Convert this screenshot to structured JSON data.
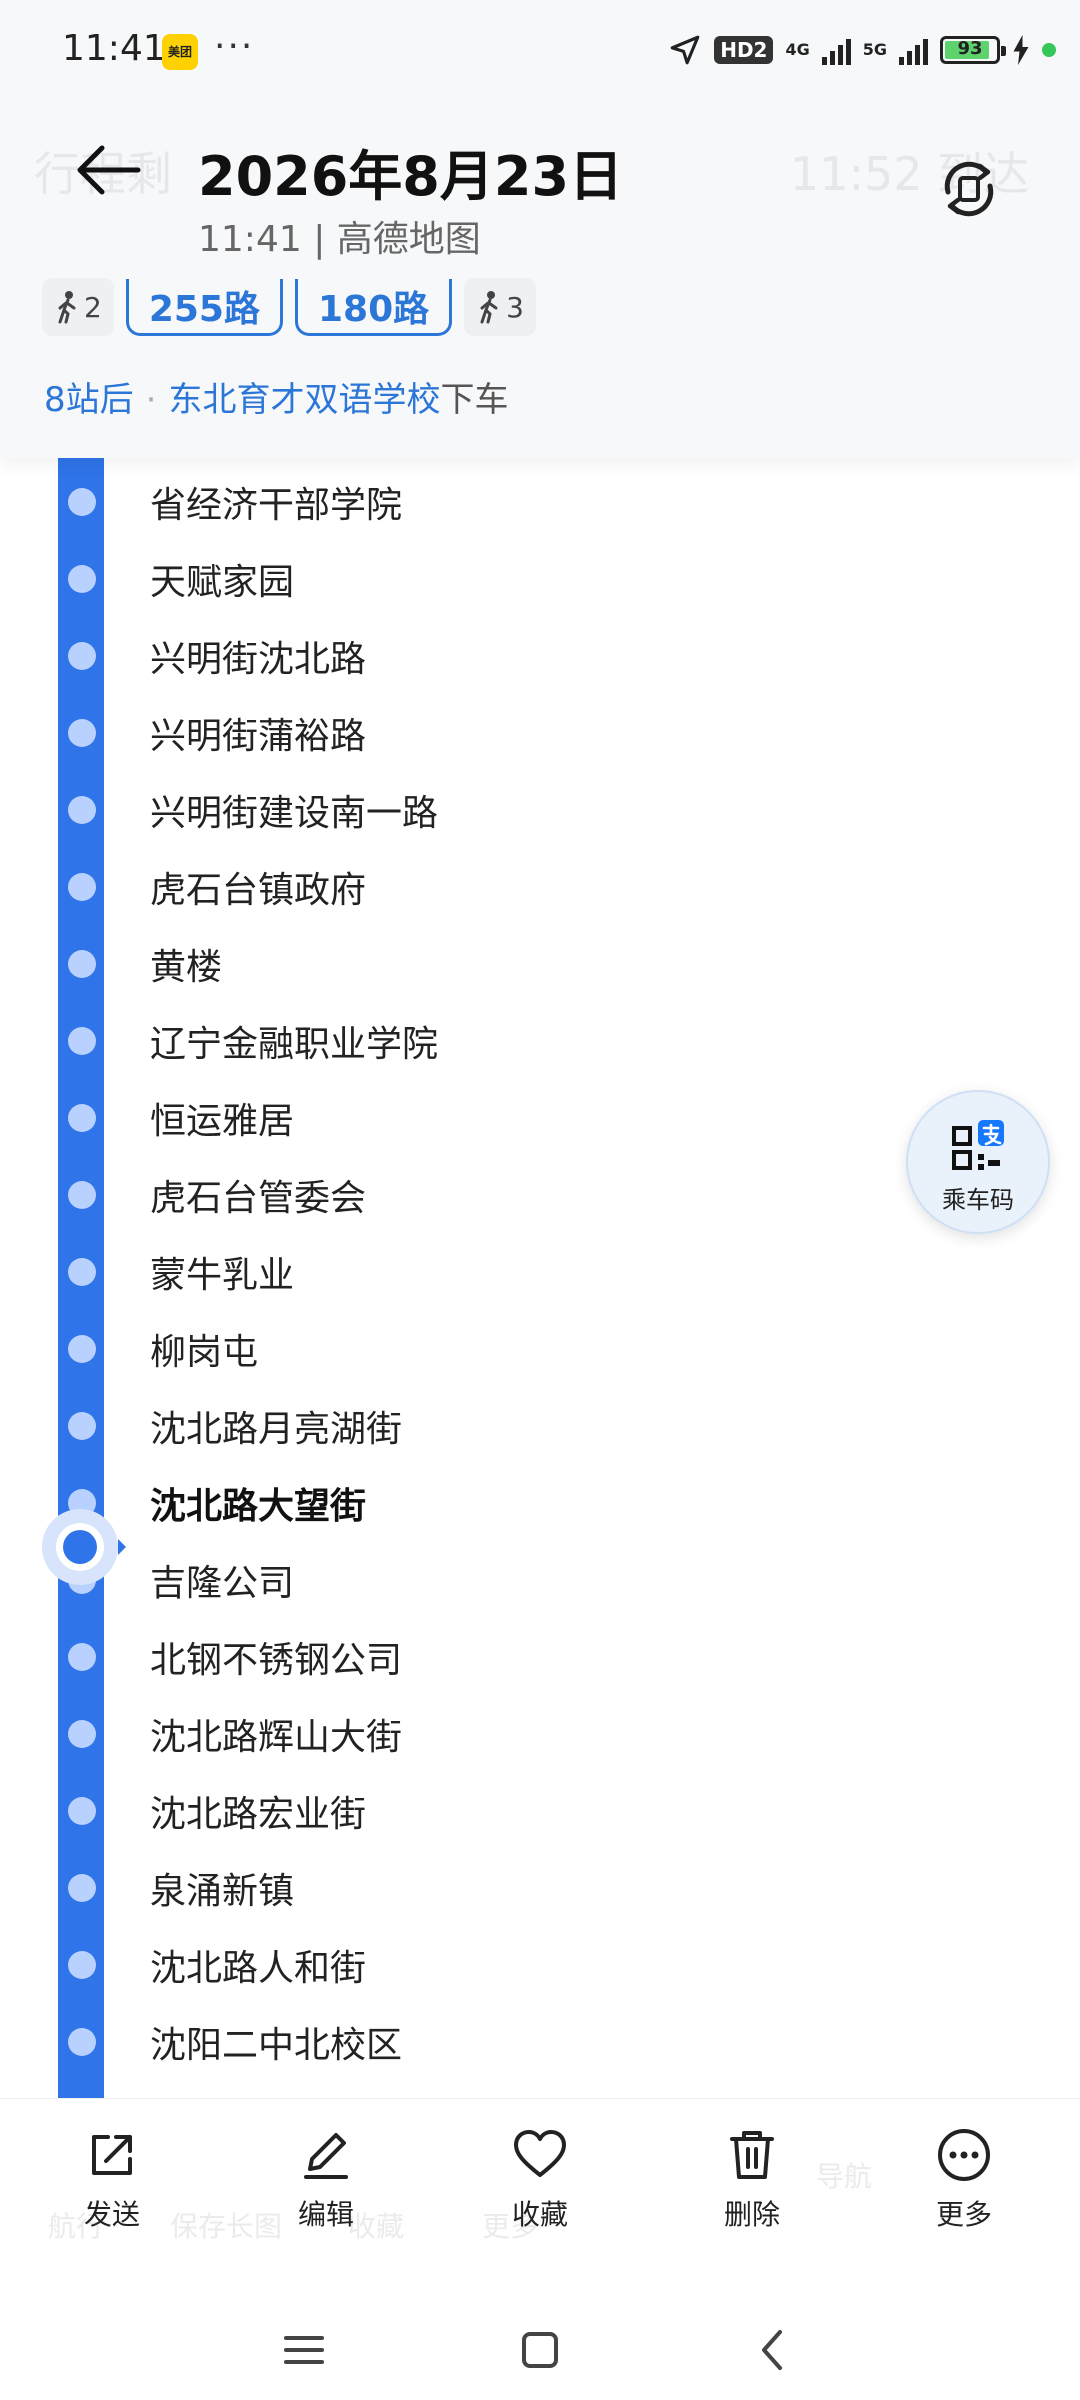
{
  "status_bar": {
    "time": "11:41",
    "app_badge": "美团",
    "more": "···",
    "hd": "HD2",
    "net1": "4G",
    "net2": "5G",
    "battery": "93",
    "icons": [
      "location-arrow-icon",
      "signal-icon",
      "battery-icon",
      "charging-icon"
    ]
  },
  "header": {
    "ghost_left": "行程剩",
    "ghost_right": "11:52 到达",
    "title": "2026年8月23日",
    "subtitle": "11:41 | 高德地图",
    "chips": {
      "walk1": "2",
      "bus1": "255路",
      "bus2": "180路",
      "walk2": "3"
    },
    "alight": {
      "stops": "8站后",
      "sep": "·",
      "station": "东北育才双语学校",
      "action": "下车"
    }
  },
  "stations": [
    "省经济干部学院",
    "天赋家园",
    "兴明街沈北路",
    "兴明街蒲裕路",
    "兴明街建设南一路",
    "虎石台镇政府",
    "黄楼",
    "辽宁金融职业学院",
    "恒运雅居",
    "虎石台管委会",
    "蒙牛乳业",
    "柳岗屯",
    "沈北路月亮湖街",
    "沈北路大望街",
    "吉隆公司",
    "北钢不锈钢公司",
    "沈北路辉山大街",
    "沈北路宏业街",
    "泉涌新镇",
    "沈北路人和街",
    "沈阳二中北校区"
  ],
  "current_station": "沈北路大望街",
  "ride_code": {
    "label": "乘车码"
  },
  "toolbar": {
    "send": "发送",
    "edit": "编辑",
    "favorite": "收藏",
    "delete": "删除",
    "more": "更多",
    "ghost_labels": [
      "航行",
      "保存长图",
      "收藏",
      "更多",
      "导航"
    ]
  },
  "colors": {
    "route_blue": "#2f74e8",
    "accent_blue": "#2c76d8",
    "node": "#b8d1ff"
  }
}
